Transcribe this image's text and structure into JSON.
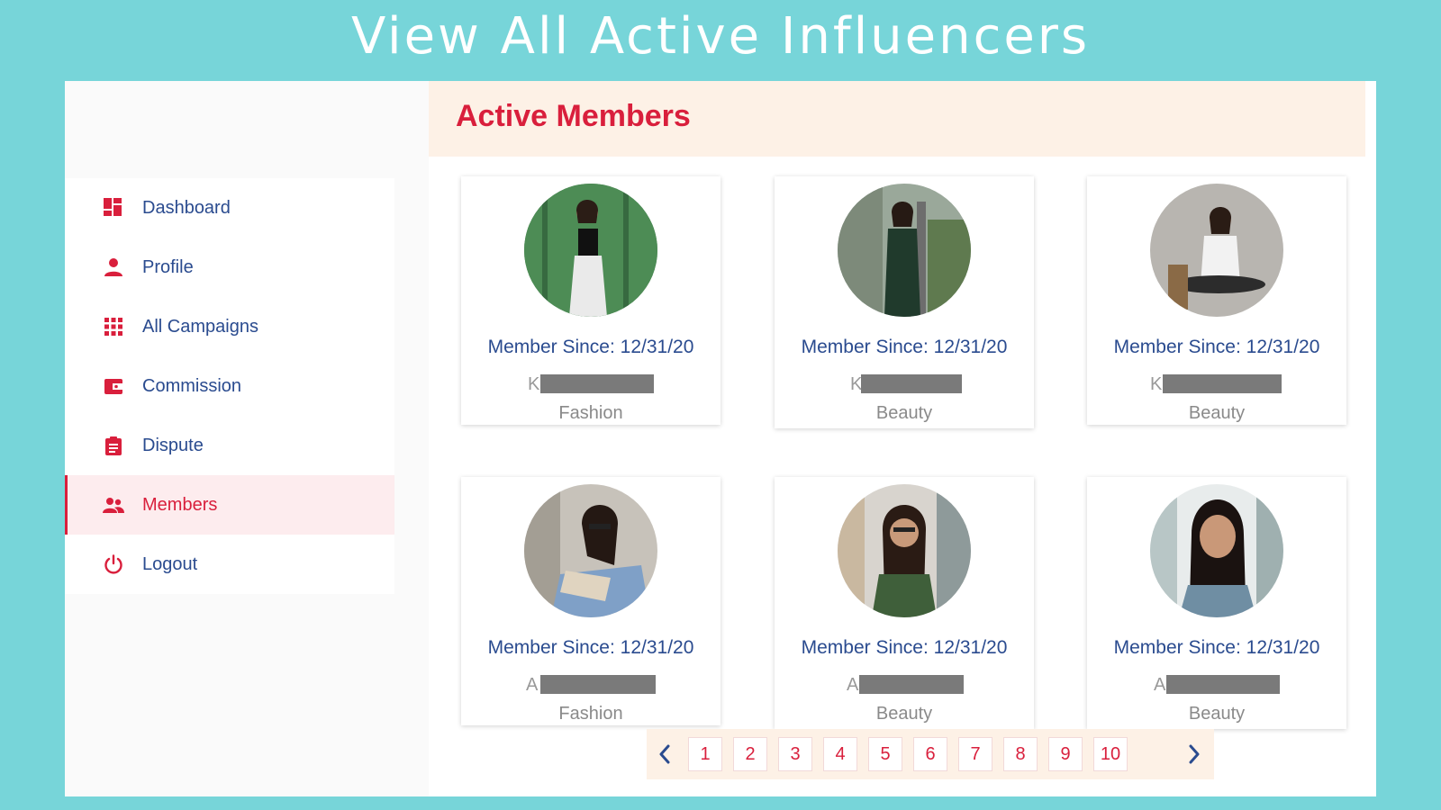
{
  "banner": {
    "title": "View All Active Influencers"
  },
  "sidebar": {
    "items": [
      {
        "label": "Dashboard",
        "icon": "dashboard-icon"
      },
      {
        "label": "Profile",
        "icon": "person-icon"
      },
      {
        "label": "All Campaigns",
        "icon": "grid-icon"
      },
      {
        "label": "Commission",
        "icon": "wallet-icon"
      },
      {
        "label": "Dispute",
        "icon": "clipboard-icon"
      },
      {
        "label": "Members",
        "icon": "people-icon",
        "active": true
      },
      {
        "label": "Logout",
        "icon": "power-icon"
      }
    ]
  },
  "content": {
    "title": "Active Members",
    "members": [
      {
        "member_since": "Member Since: 12/31/20",
        "initial": "K",
        "category": "Fashion"
      },
      {
        "member_since": "Member Since: 12/31/20",
        "initial": "K",
        "category": "Beauty"
      },
      {
        "member_since": "Member Since: 12/31/20",
        "initial": "K",
        "category": "Beauty"
      },
      {
        "member_since": "Member Since: 12/31/20",
        "initial": "A",
        "category": "Fashion"
      },
      {
        "member_since": "Member Since: 12/31/20",
        "initial": "A",
        "category": "Beauty"
      },
      {
        "member_since": "Member Since: 12/31/20",
        "initial": "A",
        "category": "Beauty"
      }
    ]
  },
  "pagination": {
    "pages": [
      "1",
      "2",
      "3",
      "4",
      "5",
      "6",
      "7",
      "8",
      "9",
      "10"
    ],
    "prev_icon": "chevron-left-icon",
    "next_icon": "chevron-right-icon"
  },
  "colors": {
    "background": "#77d5d9",
    "accent": "#d91f3c",
    "text_blue": "#2a4b8f",
    "header_bg": "#fdf1e6"
  }
}
